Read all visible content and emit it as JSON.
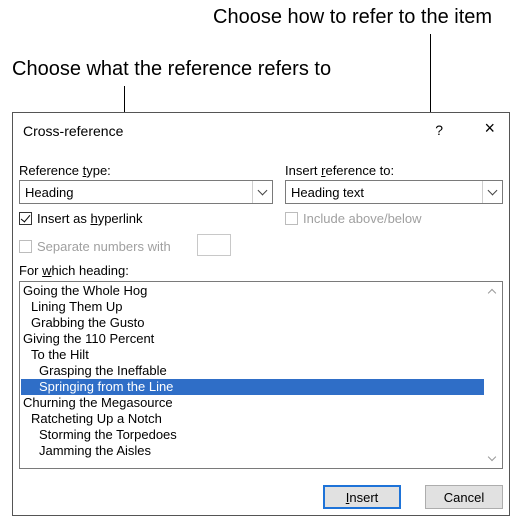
{
  "callouts": {
    "right": "Choose how to refer to the item",
    "left": "Choose what the reference refers to"
  },
  "dialog": {
    "title": "Cross-reference",
    "help": "?",
    "close": "×",
    "reference_type": {
      "label_pre": "Reference ",
      "label_u": "t",
      "label_post": "ype:",
      "value": "Heading"
    },
    "insert_reference_to": {
      "label_pre": "Insert ",
      "label_u": "r",
      "label_post": "eference to:",
      "value": "Heading text"
    },
    "insert_as_hyperlink": {
      "label_pre": "Insert as ",
      "label_u": "h",
      "label_post": "yperlink",
      "checked": true
    },
    "include_above_below": {
      "label": "Include above/below",
      "checked": false,
      "enabled": false
    },
    "separate_numbers": {
      "label": "Separate numbers with",
      "checked": false,
      "enabled": false
    },
    "for_which_heading": {
      "label_pre": "For ",
      "label_u": "w",
      "label_post": "hich heading:"
    },
    "headings": [
      {
        "text": "Going the Whole Hog",
        "level": 0
      },
      {
        "text": "Lining Them Up",
        "level": 1
      },
      {
        "text": "Grabbing the Gusto",
        "level": 1
      },
      {
        "text": "Giving the 110 Percent",
        "level": 0
      },
      {
        "text": "To the Hilt",
        "level": 1
      },
      {
        "text": "Grasping the Ineffable",
        "level": 2
      },
      {
        "text": "Springing from the Line",
        "level": 2,
        "selected": true
      },
      {
        "text": "Churning the Megasource",
        "level": 0
      },
      {
        "text": "Ratcheting Up a Notch",
        "level": 1
      },
      {
        "text": "Storming the Torpedoes",
        "level": 2
      },
      {
        "text": "Jamming the Aisles",
        "level": 2
      }
    ],
    "insert_button": {
      "label_u": "I",
      "label_post": "nsert"
    },
    "cancel_button": "Cancel"
  }
}
